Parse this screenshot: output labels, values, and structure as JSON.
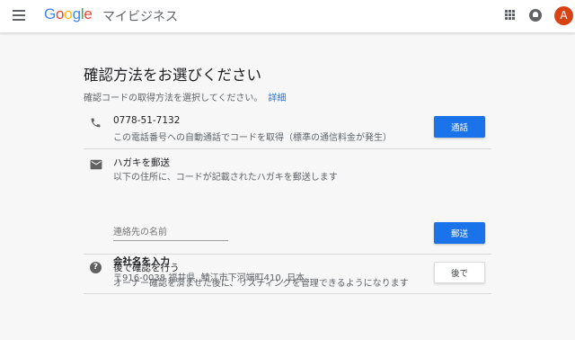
{
  "header": {
    "brand": [
      "G",
      "o",
      "o",
      "g",
      "l",
      "e"
    ],
    "product": "マイビジネス",
    "avatar_letter": "A"
  },
  "page": {
    "title": "確認方法をお選びください",
    "subtitle": "確認コードの取得方法を選択してください。",
    "details_link": "詳細"
  },
  "options": {
    "phone": {
      "title": "0778-51-7132",
      "desc": "この電話番号への自動通話でコードを取得（標準の通信料金が発生）",
      "button": "通話",
      "icon": "phone-icon"
    },
    "postcard": {
      "title": "ハガキを郵送",
      "desc": "以下の住所に、コードが記載されたハガキを郵送します",
      "contact_placeholder": "連絡先の名前",
      "contact_value": "",
      "business_name": "会社名を入力",
      "address": "〒916-0038 福井県, 鯖江市下河端町410, 日本",
      "button": "郵送",
      "icon": "mail-icon"
    },
    "later": {
      "title": "後で確認を行う",
      "desc": "オーナー確認を済ませた後に、リスティングを管理できるようになります",
      "button": "後で",
      "icon": "help-icon"
    }
  },
  "colors": {
    "accent": "#1a73e8",
    "avatar": "#d84315"
  }
}
